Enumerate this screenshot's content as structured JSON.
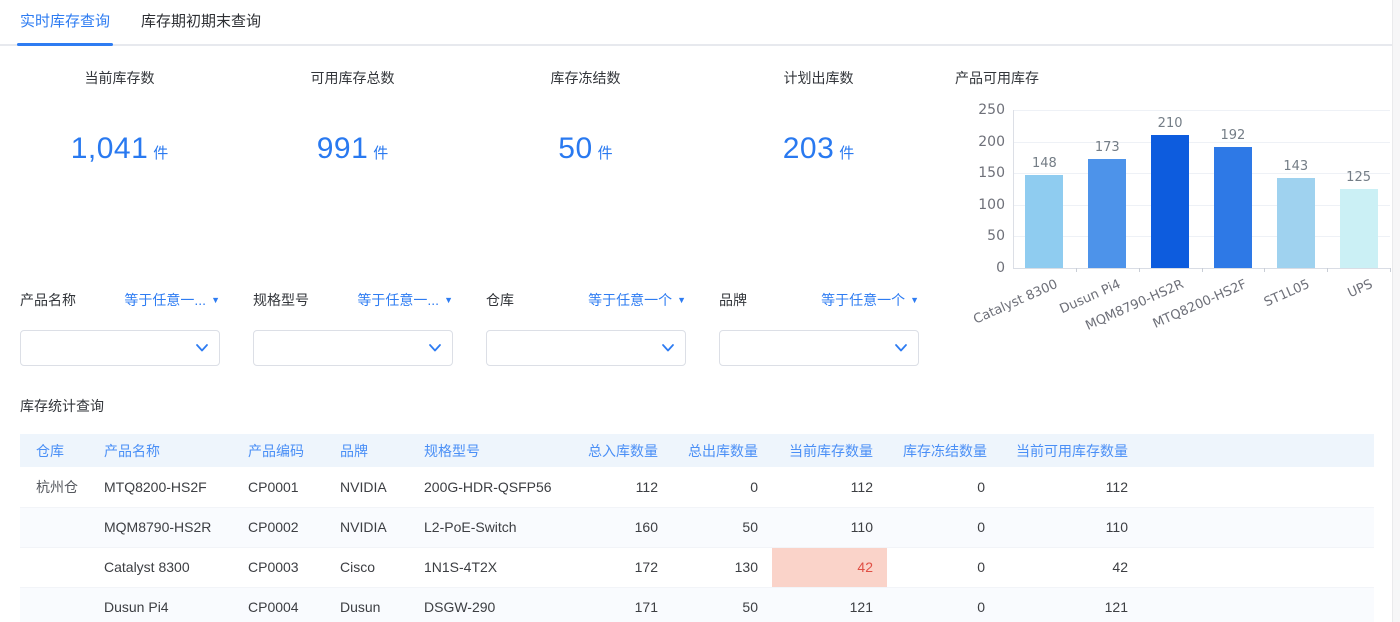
{
  "tabs": [
    {
      "label": "实时库存查询",
      "active": true
    },
    {
      "label": "库存期初期末查询",
      "active": false
    }
  ],
  "kpis": [
    {
      "name": "current-stock",
      "label": "当前库存数",
      "value": "1,041",
      "unit": "件"
    },
    {
      "name": "available-stock",
      "label": "可用库存总数",
      "value": "991",
      "unit": "件"
    },
    {
      "name": "frozen-stock",
      "label": "库存冻结数",
      "value": "50",
      "unit": "件"
    },
    {
      "name": "planned-outbound",
      "label": "计划出库数",
      "value": "203",
      "unit": "件"
    }
  ],
  "chart_data": {
    "type": "bar",
    "title": "产品可用库存",
    "categories": [
      "Catalyst 8300",
      "Dusun Pi4",
      "MQM8790-HS2R",
      "MTQ8200-HS2F",
      "ST1L05",
      "UPS"
    ],
    "values": [
      148,
      173,
      210,
      192,
      143,
      125
    ],
    "bar_colors": [
      "#8fccf0",
      "#4d93ea",
      "#0d5cde",
      "#2e79e6",
      "#9fd2ef",
      "#cbf0f5"
    ],
    "xlabel": "",
    "ylabel": "",
    "ylim": [
      0,
      250
    ],
    "yticks": [
      0,
      50,
      100,
      150,
      200,
      250
    ],
    "grid": true,
    "legend": "none"
  },
  "filters": [
    {
      "name": "product-name",
      "label": "产品名称",
      "operator": "等于任意一...",
      "value": ""
    },
    {
      "name": "spec-model",
      "label": "规格型号",
      "operator": "等于任意一...",
      "value": ""
    },
    {
      "name": "warehouse",
      "label": "仓库",
      "operator": "等于任意一个",
      "value": ""
    },
    {
      "name": "brand",
      "label": "品牌",
      "operator": "等于任意一个",
      "value": ""
    }
  ],
  "table": {
    "title": "库存统计查询",
    "columns": [
      "仓库",
      "产品名称",
      "产品编码",
      "品牌",
      "规格型号",
      "总入库数量",
      "总出库数量",
      "当前库存数量",
      "库存冻结数量",
      "当前可用库存数量"
    ],
    "rows": [
      [
        "杭州仓",
        "MTQ8200-HS2F",
        "CP0001",
        "NVIDIA",
        "200G-HDR-QSFP56",
        "112",
        "0",
        "112",
        "0",
        "112"
      ],
      [
        "",
        "MQM8790-HS2R",
        "CP0002",
        "NVIDIA",
        "L2-PoE-Switch",
        "160",
        "50",
        "110",
        "0",
        "110"
      ],
      [
        "",
        "Catalyst 8300",
        "CP0003",
        "Cisco",
        "1N1S-4T2X",
        "172",
        "130",
        "42",
        "0",
        "42"
      ],
      [
        "",
        "Dusun Pi4",
        "CP0004",
        "Dusun",
        "DSGW-290",
        "171",
        "50",
        "121",
        "0",
        "121"
      ]
    ],
    "highlight_cell": {
      "row_index": 2,
      "col_index": 7,
      "bg": "#fad3c9",
      "color": "#e04f44"
    }
  }
}
